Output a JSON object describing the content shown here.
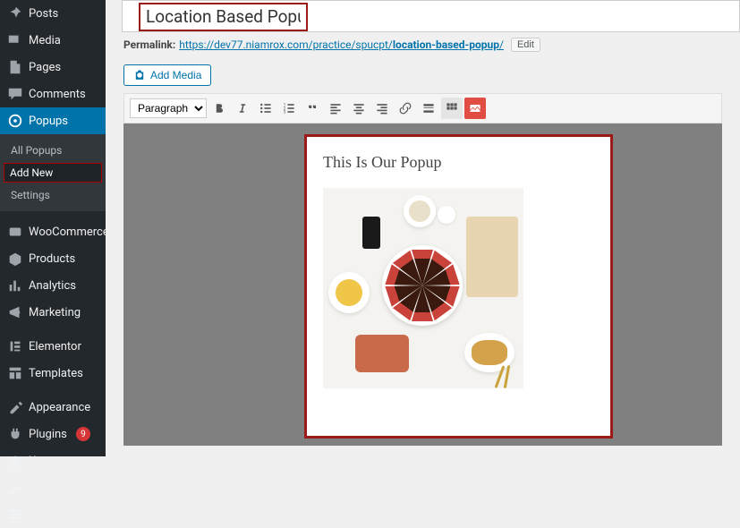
{
  "sidebar": {
    "items": [
      {
        "label": "Posts"
      },
      {
        "label": "Media"
      },
      {
        "label": "Pages"
      },
      {
        "label": "Comments"
      },
      {
        "label": "Popups"
      },
      {
        "label": "WooCommerce"
      },
      {
        "label": "Products"
      },
      {
        "label": "Analytics"
      },
      {
        "label": "Marketing"
      },
      {
        "label": "Elementor"
      },
      {
        "label": "Templates"
      },
      {
        "label": "Appearance"
      },
      {
        "label": "Plugins"
      },
      {
        "label": "Users"
      },
      {
        "label": "Tools"
      },
      {
        "label": "Settings"
      }
    ],
    "popups_submenu": [
      {
        "label": "All Popups"
      },
      {
        "label": "Add New"
      },
      {
        "label": "Settings"
      }
    ],
    "plugins_badge": "9"
  },
  "editor": {
    "title": "Location Based Popup",
    "permalink_label": "Permalink:",
    "permalink_base": "https://dev77.niamrox.com/practice/spucpt/",
    "permalink_slug": "location-based-popup",
    "permalink_trail": "/",
    "edit_label": "Edit",
    "add_media_label": "Add Media",
    "paragraph_label": "Paragraph"
  },
  "popup": {
    "heading": "This Is Our Popup"
  }
}
